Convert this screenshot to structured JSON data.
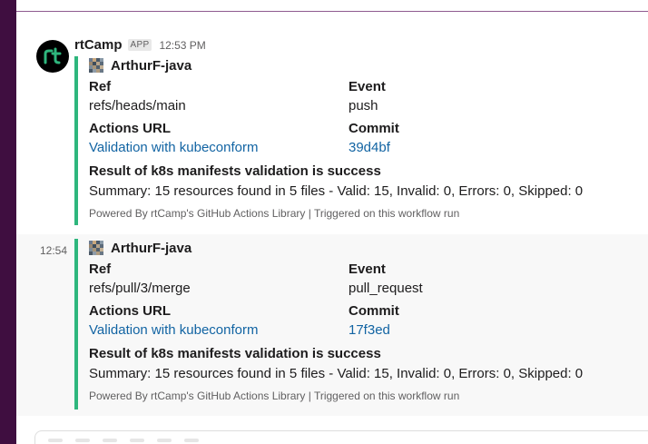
{
  "colors": {
    "sidebar": "#3f0e40",
    "attachment_bar": "#2eb67d",
    "link": "#1264a3"
  },
  "messages": [
    {
      "sender": "rtCamp",
      "badge": "APP",
      "time": "12:53 PM",
      "author": "ArthurF-java",
      "fields": [
        {
          "title": "Ref",
          "value": "refs/heads/main",
          "link": false
        },
        {
          "title": "Event",
          "value": "push",
          "link": false
        },
        {
          "title": "Actions URL",
          "value": "Validation with kubeconform",
          "link": true
        },
        {
          "title": "Commit",
          "value": "39d4bf",
          "link": true
        }
      ],
      "result_title": "Result of k8s manifests validation is success",
      "summary": "Summary: 15 resources found in 5 files - Valid: 15, Invalid: 0, Errors: 0, Skipped: 0",
      "footer": "Powered By rtCamp's GitHub Actions Library | Triggered on this workflow run"
    },
    {
      "time": "12:54",
      "author": "ArthurF-java",
      "fields": [
        {
          "title": "Ref",
          "value": "refs/pull/3/merge",
          "link": false
        },
        {
          "title": "Event",
          "value": "pull_request",
          "link": false
        },
        {
          "title": "Actions URL",
          "value": "Validation with kubeconform",
          "link": true
        },
        {
          "title": "Commit",
          "value": "17f3ed",
          "link": true
        }
      ],
      "result_title": "Result of k8s manifests validation is success",
      "summary": "Summary: 15 resources found in 5 files - Valid: 15, Invalid: 0, Errors: 0, Skipped: 0",
      "footer": "Powered By rtCamp's GitHub Actions Library | Triggered on this workflow run"
    }
  ]
}
